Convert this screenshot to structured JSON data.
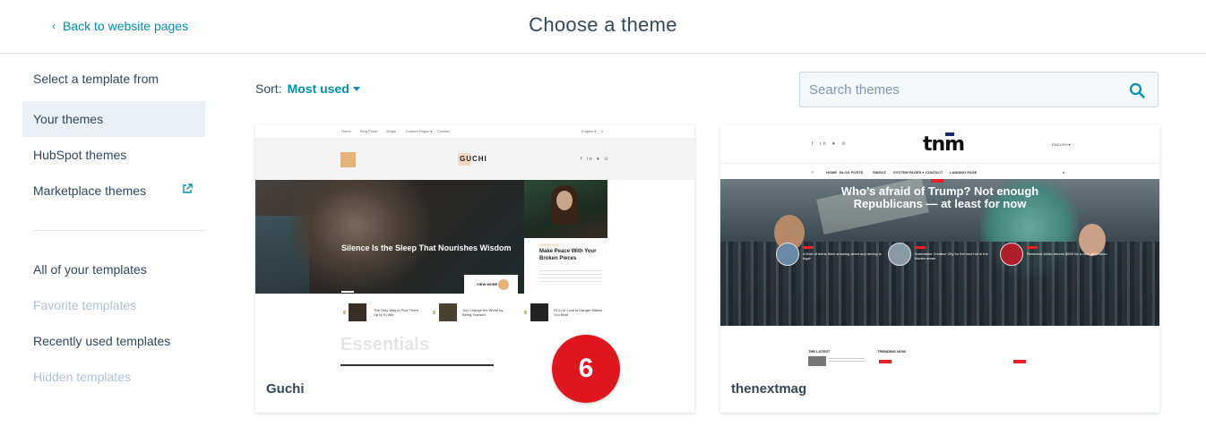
{
  "header": {
    "back_label": "Back to website pages",
    "title": "Choose a theme"
  },
  "sidebar": {
    "heading": "Select a template from",
    "sources": [
      {
        "label": "Your themes",
        "active": true
      },
      {
        "label": "HubSpot themes",
        "active": false
      },
      {
        "label": "Marketplace themes",
        "active": false,
        "icon": "external-link-icon"
      }
    ],
    "templates": [
      {
        "label": "All of your templates",
        "enabled": true
      },
      {
        "label": "Favorite templates",
        "enabled": false
      },
      {
        "label": "Recently used templates",
        "enabled": true
      },
      {
        "label": "Hidden templates",
        "enabled": false
      }
    ]
  },
  "toolbar": {
    "sort_label": "Sort:",
    "sort_value": "Most used",
    "search_placeholder": "Search themes"
  },
  "themes": [
    {
      "name": "Guchi",
      "preview": {
        "nav": [
          "Home",
          "Blog Posts",
          "Single",
          "Custom Pages ▾",
          "Contact",
          "English ▾",
          "⌕"
        ],
        "logo": "GUCHI",
        "social": "f in ♥ ⊙",
        "hero_title": "Silence Is the Sleep That Nourishes Wisdom",
        "side_tag": "LIFESTYLE",
        "side_title": "Make Peace With Your Broken Pieces",
        "view_more": "VIEW MORE",
        "rows": [
          "The Only Way to Find Them Up Is To Win",
          "You Change the World by Being Yourself",
          "Fit in or Love is Danger Makes You Best"
        ],
        "section_title": "Essentials"
      }
    },
    {
      "name": "thenextmag",
      "preview": {
        "social": "f in ♥ ⊙",
        "logo": "tnm",
        "lang": "ENGLISH ▾",
        "nav": [
          "≡",
          "HOME",
          "BLOG POSTS",
          "SINGLE",
          "SYSTEM PAGES ▾",
          "CONTACT",
          "LANDING PAGE",
          "⌕"
        ],
        "hero_title": "Who’s afraid of Trump? Not enough Republicans — at least for now",
        "subs": [
          "A third of teens think smoking weed and driving is legal",
          "Submarine Creative City for the new hot in the hidden areas",
          "Reverend Arlida returns $500 for a new generation"
        ],
        "latest_label": "THE LATEST",
        "trending_label": "TRENDING NOW"
      }
    }
  ],
  "badge": {
    "value": "6",
    "color": "#e0161f"
  },
  "colors": {
    "accent": "#0091ae",
    "text": "#33475b",
    "active_bg": "#eaf0f6",
    "muted": "#b0c1d4"
  }
}
